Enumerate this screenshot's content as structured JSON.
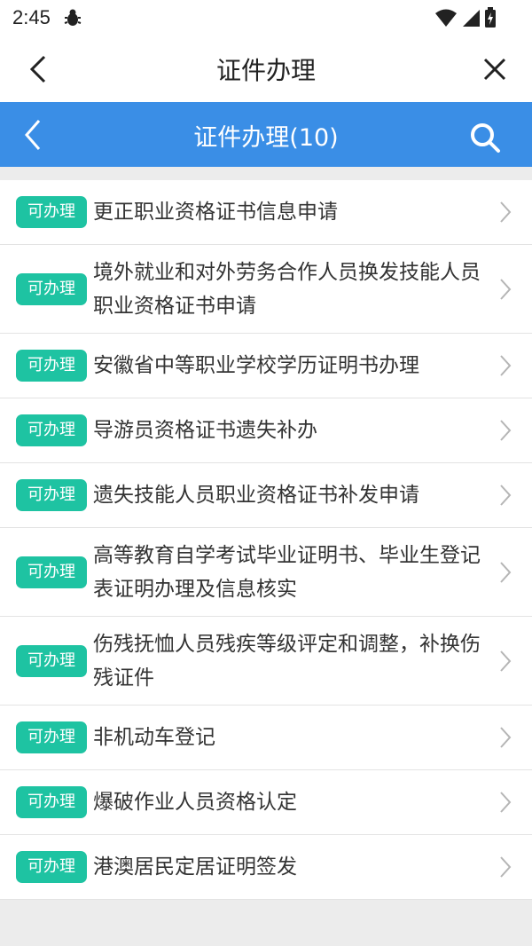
{
  "status": {
    "time": "2:45"
  },
  "titlebar": {
    "title": "证件办理"
  },
  "header": {
    "title": "证件办理(10)"
  },
  "colors": {
    "header_blue": "#3a8ee6",
    "badge_green": "#1ec3a2"
  },
  "items": [
    {
      "badge": "可办理",
      "label": "更正职业资格证书信息申请"
    },
    {
      "badge": "可办理",
      "label": "境外就业和对外劳务合作人员换发技能人员职业资格证书申请"
    },
    {
      "badge": "可办理",
      "label": "安徽省中等职业学校学历证明书办理"
    },
    {
      "badge": "可办理",
      "label": "导游员资格证书遗失补办"
    },
    {
      "badge": "可办理",
      "label": "遗失技能人员职业资格证书补发申请"
    },
    {
      "badge": "可办理",
      "label": "高等教育自学考试毕业证明书、毕业生登记表证明办理及信息核实"
    },
    {
      "badge": "可办理",
      "label": "伤残抚恤人员残疾等级评定和调整，补换伤残证件"
    },
    {
      "badge": "可办理",
      "label": "非机动车登记"
    },
    {
      "badge": "可办理",
      "label": "爆破作业人员资格认定"
    },
    {
      "badge": "可办理",
      "label": "港澳居民定居证明签发"
    }
  ]
}
